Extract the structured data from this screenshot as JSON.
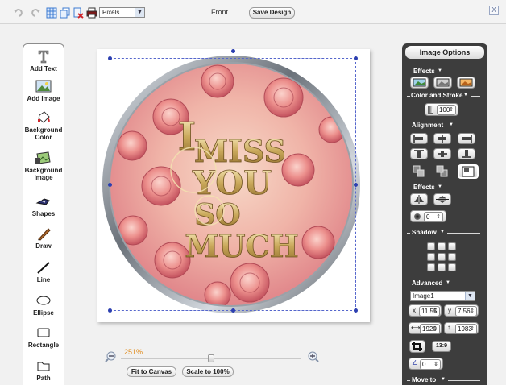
{
  "topbar": {
    "undo_icon": "undo-icon",
    "redo_icon": "redo-icon",
    "grid_icon": "grid-icon",
    "copy_icon": "copy-icon",
    "delete_icon": "delete-icon",
    "print_icon": "print-icon",
    "unit_value": "Pixels",
    "side_label": "Front",
    "save_label": "Save Design",
    "close_label": "X"
  },
  "tools": [
    {
      "label": "Add Text",
      "icon": "text-t-icon"
    },
    {
      "label": "Add Image",
      "icon": "image-icon"
    },
    {
      "label": "Background Color",
      "icon": "paint-bucket-icon"
    },
    {
      "label": "Background Image",
      "icon": "background-image-icon"
    },
    {
      "label": "Shapes",
      "icon": "shapes-icon"
    },
    {
      "label": "Draw",
      "icon": "pencil-icon"
    },
    {
      "label": "Line",
      "icon": "line-icon"
    },
    {
      "label": "Ellipse",
      "icon": "ellipse-icon"
    },
    {
      "label": "Rectangle",
      "icon": "rectangle-icon"
    },
    {
      "label": "Path",
      "icon": "path-icon"
    }
  ],
  "canvas": {
    "artwork_text_lines": [
      "I",
      "MISS",
      "YOU",
      "SO",
      "MUCH"
    ],
    "artwork_colors": {
      "rose": "#e8808a",
      "gold": "#c9a85a",
      "ring": "#8a929c"
    }
  },
  "zoom": {
    "percent": "251%",
    "fit_label": "Fit to Canvas",
    "scale_label": "Scale to 100%",
    "value_fraction": 0.5
  },
  "image_options": {
    "title": "Image Options",
    "effects_title": "Effects",
    "color_stroke_title": "Color and Stroke",
    "opacity_value": "100",
    "alignment_title": "Alignment",
    "effects2_title": "Effects",
    "blur_value": "0",
    "shadow_title": "Shadow",
    "advanced_title": "Advanced",
    "layer_value": "Image1",
    "x_label": "x",
    "x_value": "11.55",
    "y_label": "y",
    "y_value": "7.56",
    "width_value": "1920",
    "height_value": "1983",
    "ratio_label": "13:9",
    "rotation_value": "0",
    "move_to_title": "Move to"
  }
}
